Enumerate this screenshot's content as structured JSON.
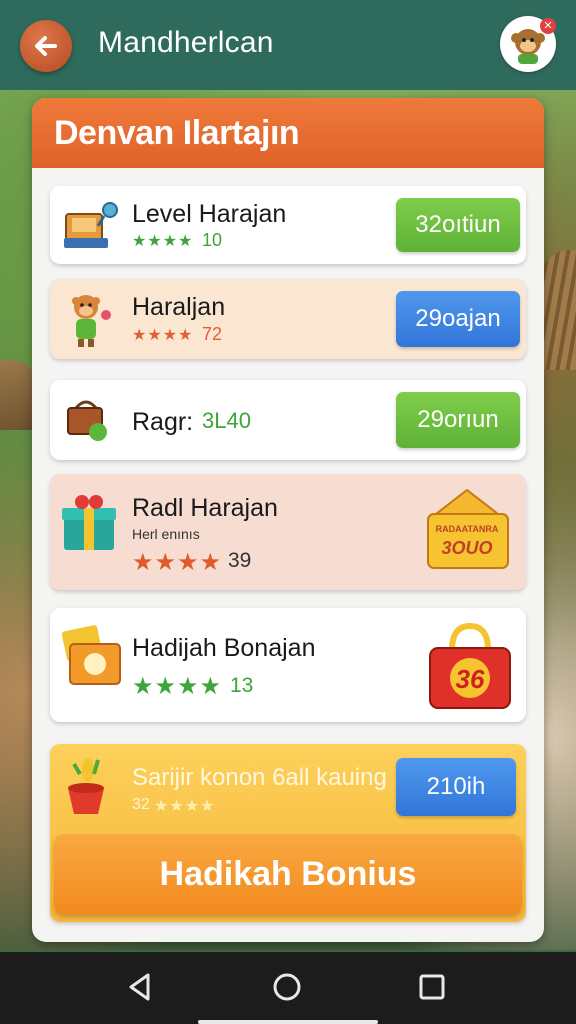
{
  "app_bar": {
    "title": "Mandherlcan",
    "back_icon": "arrow-left-icon",
    "avatar_icon": "monkey-avatar-icon"
  },
  "panel": {
    "title": "Denvan Ilartajın"
  },
  "rows": [
    {
      "name": "Level Harajan",
      "stars": "★★★★",
      "meta": "10",
      "button": "32oıtiun",
      "button_color": "#6cc03f",
      "icon": "cash-register-icon"
    },
    {
      "name": "Haraljan",
      "stars": "★★★★",
      "meta": "72",
      "button": "29oajan",
      "button_color": "#3b82e0",
      "icon": "monkey-character-icon"
    },
    {
      "name": "Ragr:",
      "meta": "3L40",
      "button": "29orıun",
      "button_color": "#6cc03f",
      "icon": "shopping-basket-icon"
    },
    {
      "name": "Radl Harajan",
      "sub": "Herl enınıs",
      "stars": "★★★★",
      "meta": "39",
      "badge": "3OUO",
      "badge_top": "RADAATANRA",
      "icon": "gift-box-icon"
    },
    {
      "name": "Hadijah Bonajan",
      "stars": "★★★★",
      "meta": "13",
      "badge": "36",
      "icon": "money-envelope-icon"
    },
    {
      "name": "Sarijir konon 6all kauing",
      "meta": "32",
      "stars": "★★★★",
      "button": "210ih",
      "button_color": "#3b82e0",
      "icon": "flower-pot-icon"
    }
  ],
  "bonus_button": "Hadikah Bonius",
  "nav": {
    "back": "nav-back-icon",
    "home": "nav-home-icon",
    "recents": "nav-recents-icon"
  },
  "colors": {
    "app_bar": "#2f6b5c",
    "header": "#e86a2f",
    "green_button": "#6cc03f",
    "blue_button": "#3b82e0",
    "bonus": "#f59a2a"
  }
}
